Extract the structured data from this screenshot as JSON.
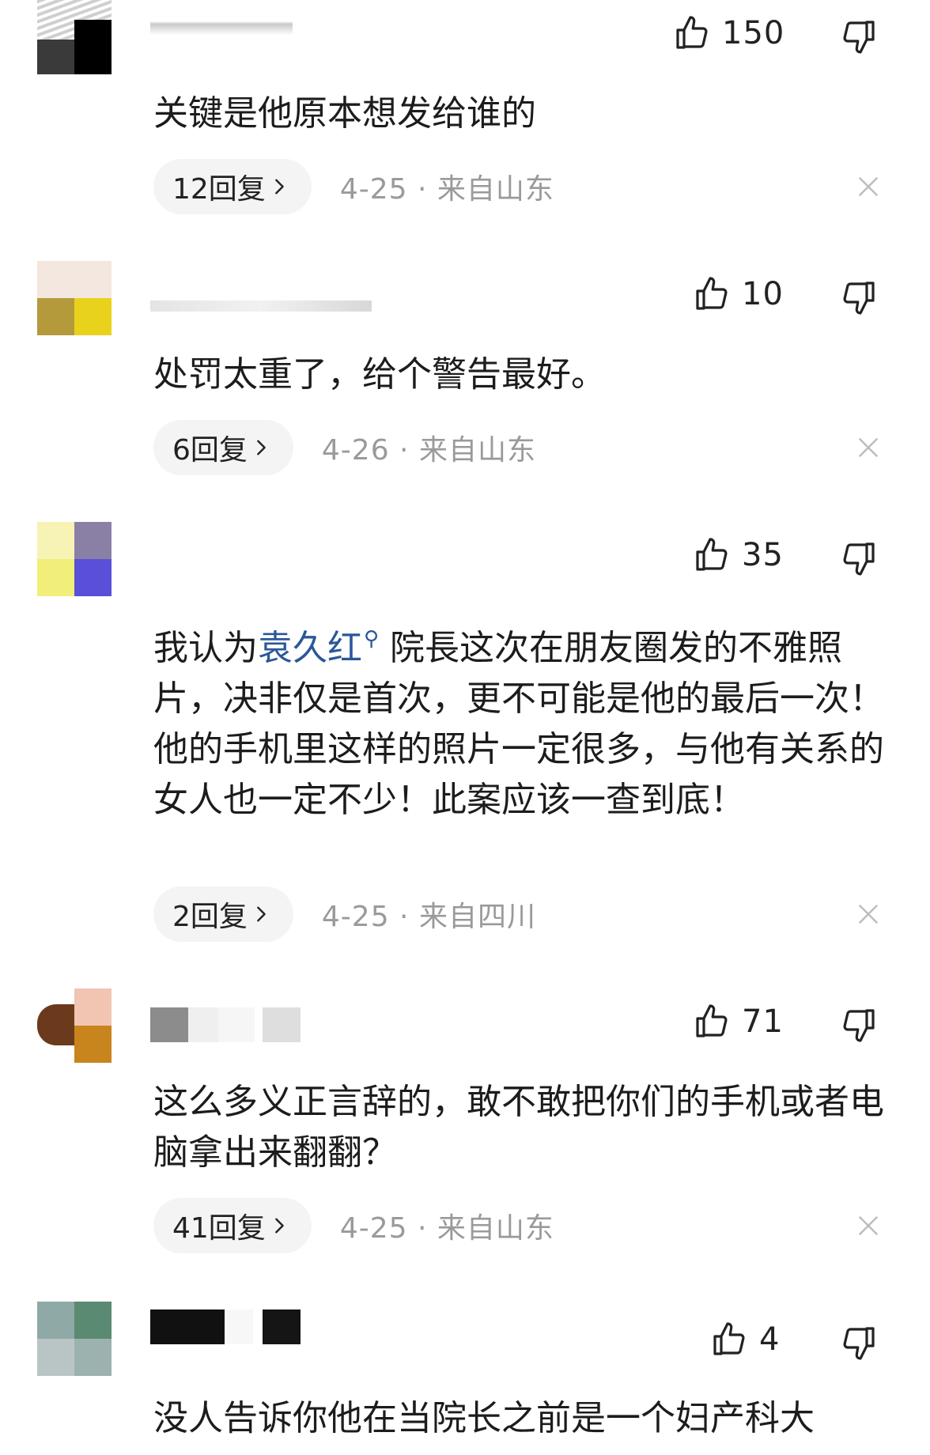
{
  "comments": [
    {
      "likes": "150",
      "text": "关键是他原本想发给谁的",
      "reply_label": "12回复",
      "meta": "4-25 · 来自山东"
    },
    {
      "likes": "10",
      "text": "处罚太重了，给个警告最好。",
      "reply_label": "6回复",
      "meta": "4-26 · 来自山东"
    },
    {
      "likes": "35",
      "text_before": "我认为",
      "mention": "袁久红",
      "text_after": " 院長这次在朋友圈发的不雅照片，决非仅是首次，更不可能是他的最后一次！他的手机里这样的照片一定很多，与他有关系的女人也一定不少！此案应该一查到底！",
      "reply_label": "2回复",
      "meta": "4-25 · 来自四川"
    },
    {
      "likes": "71",
      "text": "这么多义正言辞的，敢不敢把你们的手机或者电脑拿出来翻翻？",
      "reply_label": "41回复",
      "meta": "4-25 · 来自山东"
    },
    {
      "likes": "4",
      "text": "没人告诉你他在当院长之前是一个妇产科大"
    }
  ],
  "icons": {
    "like": "thumbs-up-icon",
    "dislike": "thumbs-down-icon",
    "dismiss": "close-icon",
    "chevron": "chevron-right-icon",
    "mention": "search-icon"
  },
  "colors": {
    "mention": "#2b5797",
    "meta": "#9a9a9a",
    "pill_bg": "#f4f4f4"
  }
}
